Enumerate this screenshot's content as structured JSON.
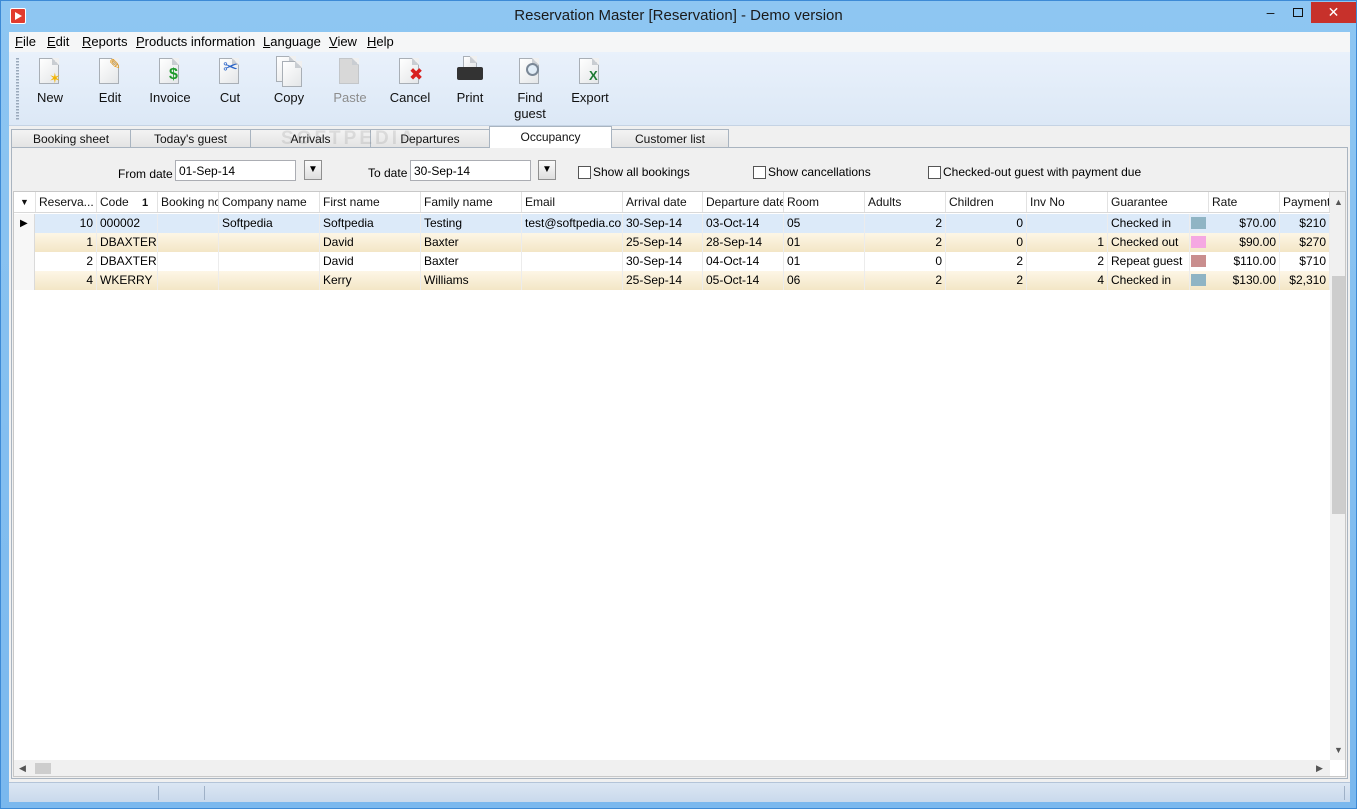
{
  "window": {
    "title": "Reservation Master [Reservation] - Demo version"
  },
  "menu": [
    "File",
    "Edit",
    "Reports",
    "Products information",
    "Language",
    "View",
    "Help"
  ],
  "toolbar": {
    "new": "New",
    "edit": "Edit",
    "invoice": "Invoice",
    "cut": "Cut",
    "copy": "Copy",
    "paste": "Paste",
    "cancel": "Cancel",
    "print": "Print",
    "find_guest_1": "Find",
    "find_guest_2": "guest",
    "export": "Export"
  },
  "tabs": [
    "Booking sheet",
    "Today's guest",
    "Arrivals",
    "Departures",
    "Occupancy",
    "Customer list"
  ],
  "active_tab": "Occupancy",
  "filter": {
    "from_label": "From date",
    "from_value": "01-Sep-14",
    "to_label": "To date",
    "to_value": "30-Sep-14",
    "show_all": "Show all bookings",
    "show_cancel": "Show cancellations",
    "checked_out_due": "Checked-out guest with payment due"
  },
  "watermark": "SOFTPEDIA",
  "columns": [
    "Reserva...",
    "Code",
    "Booking no",
    "Company name",
    "First name",
    "Family name",
    "Email",
    "Arrival date",
    "Departure date",
    "Room",
    "Adults",
    "Children",
    "Inv No",
    "Guarantee",
    "Rate",
    "Payment"
  ],
  "sort_indicator": "1",
  "rows": [
    {
      "res": "10",
      "code": "000002",
      "booking": "",
      "company": "Softpedia",
      "first": "Softpedia",
      "family": "Testing",
      "email": "test@softpedia.com",
      "arrival": "30-Sep-14",
      "departure": "03-Oct-14",
      "room": "05",
      "adults": "2",
      "children": "0",
      "inv": "",
      "guarantee": "Checked in",
      "color": "#8fb4c4",
      "rate": "$70.00",
      "payment": "$210"
    },
    {
      "res": "1",
      "code": "DBAXTER",
      "booking": "",
      "company": "",
      "first": "David",
      "family": "Baxter",
      "email": "",
      "arrival": "25-Sep-14",
      "departure": "28-Sep-14",
      "room": "01",
      "adults": "2",
      "children": "0",
      "inv": "1",
      "guarantee": "Checked out",
      "color": "#f5a8e2",
      "rate": "$90.00",
      "payment": "$270"
    },
    {
      "res": "2",
      "code": "DBAXTER",
      "booking": "",
      "company": "",
      "first": "David",
      "family": "Baxter",
      "email": "",
      "arrival": "30-Sep-14",
      "departure": "04-Oct-14",
      "room": "01",
      "adults": "0",
      "children": "2",
      "inv": "2",
      "guarantee": "Repeat guest",
      "color": "#c98e8e",
      "rate": "$110.00",
      "payment": "$710"
    },
    {
      "res": "4",
      "code": "WKERRY",
      "booking": "",
      "company": "",
      "first": "Kerry",
      "family": "Williams",
      "email": "",
      "arrival": "25-Sep-14",
      "departure": "05-Oct-14",
      "room": "06",
      "adults": "2",
      "children": "2",
      "inv": "4",
      "guarantee": "Checked in",
      "color": "#8fb4c4",
      "rate": "$130.00",
      "payment": "$2,310"
    }
  ]
}
